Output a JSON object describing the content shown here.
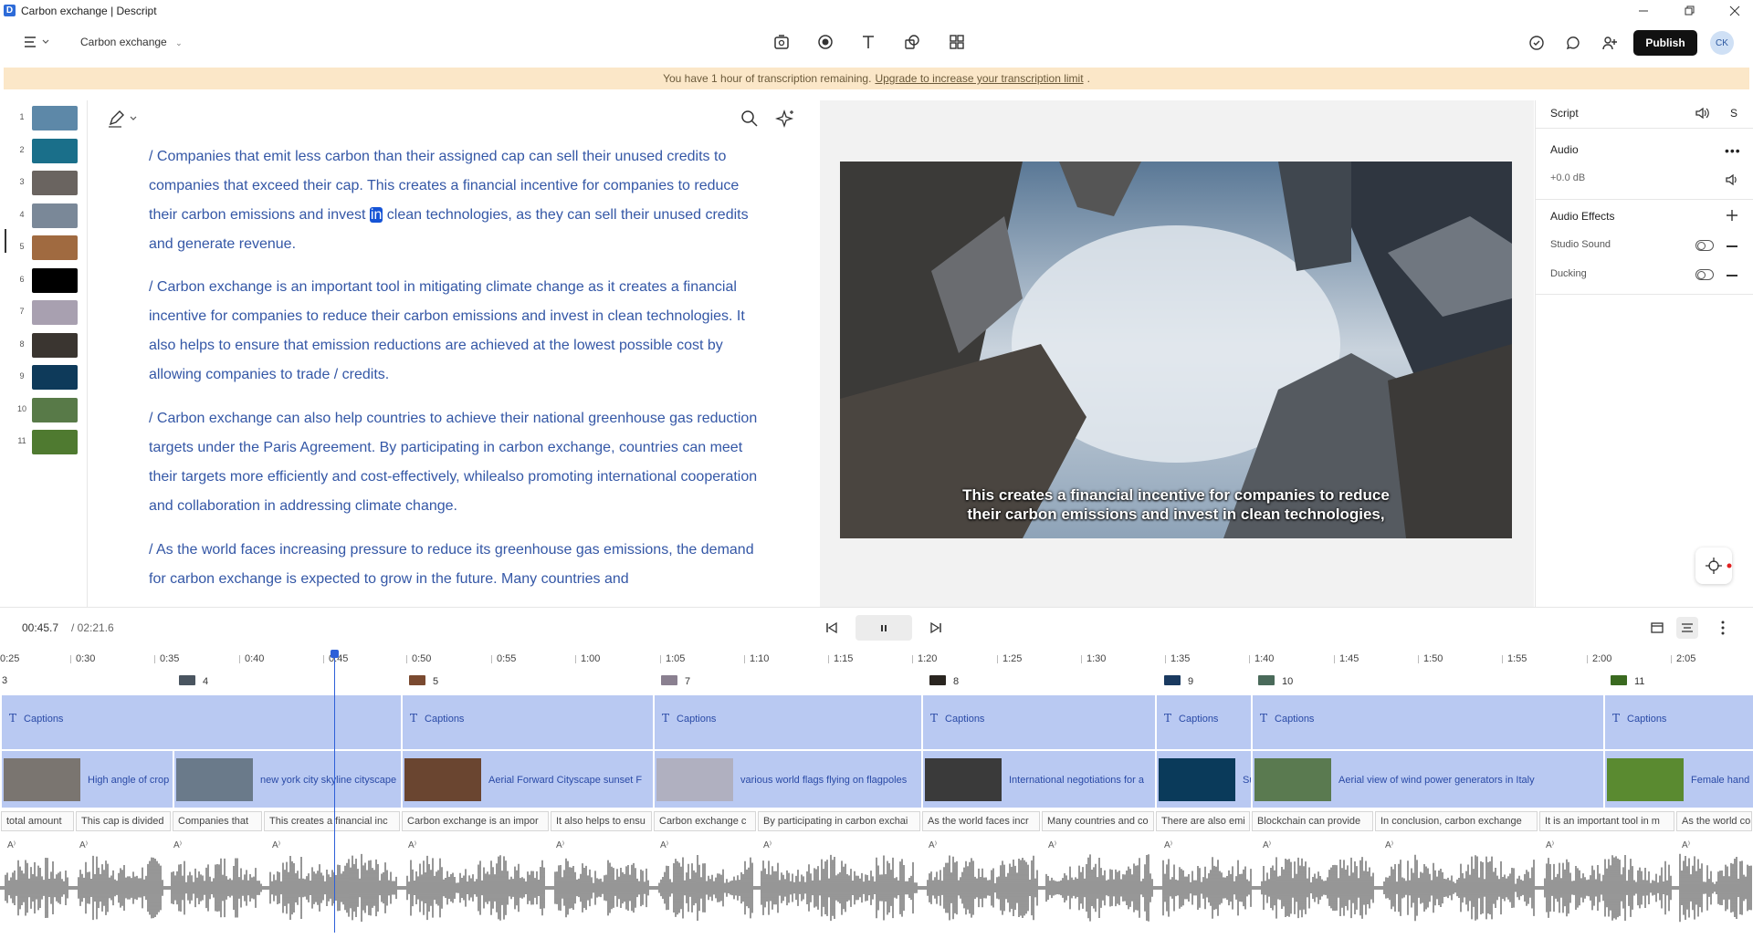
{
  "window": {
    "title": "Carbon exchange | Descript"
  },
  "toolbar": {
    "project_name": "Carbon exchange",
    "publish_label": "Publish",
    "avatar_initials": "CK"
  },
  "banner": {
    "text": "You have 1 hour of transcription remaining.",
    "link": "Upgrade to increase your transcription limit"
  },
  "scenes": [
    "1",
    "2",
    "3",
    "4",
    "5",
    "6",
    "7",
    "8",
    "9",
    "10",
    "11"
  ],
  "script": {
    "paragraphs": [
      {
        "before": "/ Companies that emit less carbon than their assigned cap can sell their unused credits to companies that exceed their cap. This creates a financial incentive for companies to reduce their carbon emissions and invest ",
        "highlight": "in",
        "after": " clean technologies, as they can sell their unused credits and generate revenue."
      },
      {
        "text": "/ Carbon exchange is an important tool in mitigating climate change as it creates a financial incentive for companies to reduce their carbon emissions and invest in clean technologies. It also helps to ensure that emission reductions are achieved at the lowest possible cost by allowing companies to trade / credits."
      },
      {
        "text": "/ Carbon exchange can also help countries to achieve their national greenhouse gas reduction targets under the Paris Agreement. By participating in carbon exchange, countries can meet their targets more efficiently and cost-effectively, whilealso promoting international cooperation and collaboration in addressing climate change."
      },
      {
        "text": "/ As the world faces increasing pressure to reduce its greenhouse gas emissions, the demand for carbon exchange is expected to grow in the future. Many countries and"
      }
    ]
  },
  "video": {
    "caption_line1": "This creates a financial incentive for companies to reduce",
    "caption_line2": "their carbon emissions and invest in clean technologies,"
  },
  "right_panel": {
    "script_label": "Script",
    "script_short": "S",
    "audio_label": "Audio",
    "gain": "+0.0 dB",
    "effects_label": "Audio Effects",
    "studio_sound": "Studio Sound",
    "ducking": "Ducking"
  },
  "transport": {
    "current": "00:45.7",
    "total": "/  02:21.6"
  },
  "ruler": [
    "0:25",
    "0:30",
    "0:35",
    "0:40",
    "0:45",
    "0:50",
    "0:55",
    "1:00",
    "1:05",
    "1:10",
    "1:15",
    "1:20",
    "1:25",
    "1:30",
    "1:35",
    "1:40",
    "1:45",
    "1:50",
    "1:55",
    "2:00",
    "2:05"
  ],
  "scene_markers": [
    "3",
    "4",
    "5",
    "7",
    "8",
    "9",
    "10",
    "11"
  ],
  "captions_label": "Captions",
  "media_clips": [
    "High angle of crop",
    "new york city skyline cityscape",
    "Aerial Forward Cityscape sunset F",
    "various world flags flying on flagpoles",
    "International negotiations for a",
    "Su",
    "Aerial view of wind power generators in Italy",
    "Female hand"
  ],
  "words": [
    "total amount",
    "This cap is divided",
    "Companies that",
    "This creates a financial inc",
    "Carbon exchange is an impor",
    "It also helps to ensu",
    "Carbon exchange c",
    "By participating in carbon exchai",
    "As the world faces incr",
    "Many countries and co",
    "There are also emi",
    "Blockchain can provide",
    "In conclusion, carbon exchange",
    "It is an important tool in m",
    "As the world co"
  ],
  "colors": {
    "accent": "#1553d6",
    "script_text": "#3457a6",
    "track": "#b9c9f2",
    "banner": "#fbe7c8"
  }
}
